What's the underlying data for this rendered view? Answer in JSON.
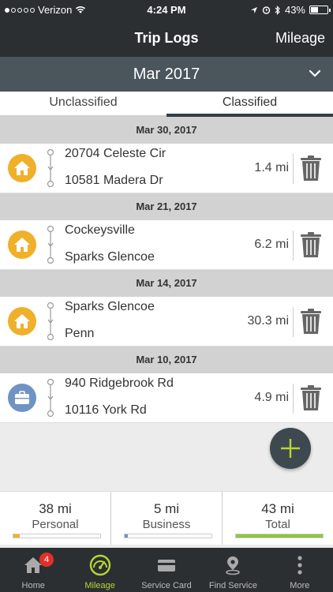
{
  "status_bar": {
    "carrier": "Verizon",
    "time": "4:24 PM",
    "battery": "43%",
    "battery_level": 0.43
  },
  "nav": {
    "title": "Trip Logs",
    "action": "Mileage"
  },
  "month_selector": {
    "label": "Mar 2017"
  },
  "tabs": [
    {
      "label": "Unclassified",
      "active": false
    },
    {
      "label": "Classified",
      "active": true
    }
  ],
  "trips": [
    {
      "date": "Mar 30, 2017",
      "from": "20704 Celeste Cir",
      "to": "10581 Madera Dr",
      "distance": "1.4 mi",
      "category": "personal",
      "icon": "home-icon"
    },
    {
      "date": "Mar 21, 2017",
      "from": "Cockeysville",
      "to": "Sparks Glencoe",
      "distance": "6.2 mi",
      "category": "personal",
      "icon": "home-icon"
    },
    {
      "date": "Mar 14, 2017",
      "from": "Sparks Glencoe",
      "to": "Penn",
      "distance": "30.3 mi",
      "category": "personal",
      "icon": "home-icon"
    },
    {
      "date": "Mar 10, 2017",
      "from": "940 Ridgebrook Rd",
      "to": "10116 York Rd",
      "distance": "4.9 mi",
      "category": "business",
      "icon": "briefcase-icon"
    }
  ],
  "summary": [
    {
      "value": "38 mi",
      "label": "Personal",
      "fill": 0.07,
      "color": "#efb02a"
    },
    {
      "value": "5 mi",
      "label": "Business",
      "fill": 0.04,
      "color": "#6f93c2"
    },
    {
      "value": "43 mi",
      "label": "Total",
      "fill": 1.0,
      "color": "#8cc63f"
    }
  ],
  "tab_bar": [
    {
      "label": "Home",
      "icon": "home-icon",
      "badge": "4",
      "active": false
    },
    {
      "label": "Mileage",
      "icon": "speedometer-icon",
      "active": true
    },
    {
      "label": "Service Card",
      "icon": "card-icon",
      "active": false
    },
    {
      "label": "Find Service",
      "icon": "location-pin-icon",
      "active": false
    },
    {
      "label": "More",
      "icon": "more-icon",
      "active": false
    }
  ],
  "colors": {
    "personal": "#efb02a",
    "business": "#6f93c2",
    "accent": "#b7d435",
    "header": "#2b2f32"
  }
}
